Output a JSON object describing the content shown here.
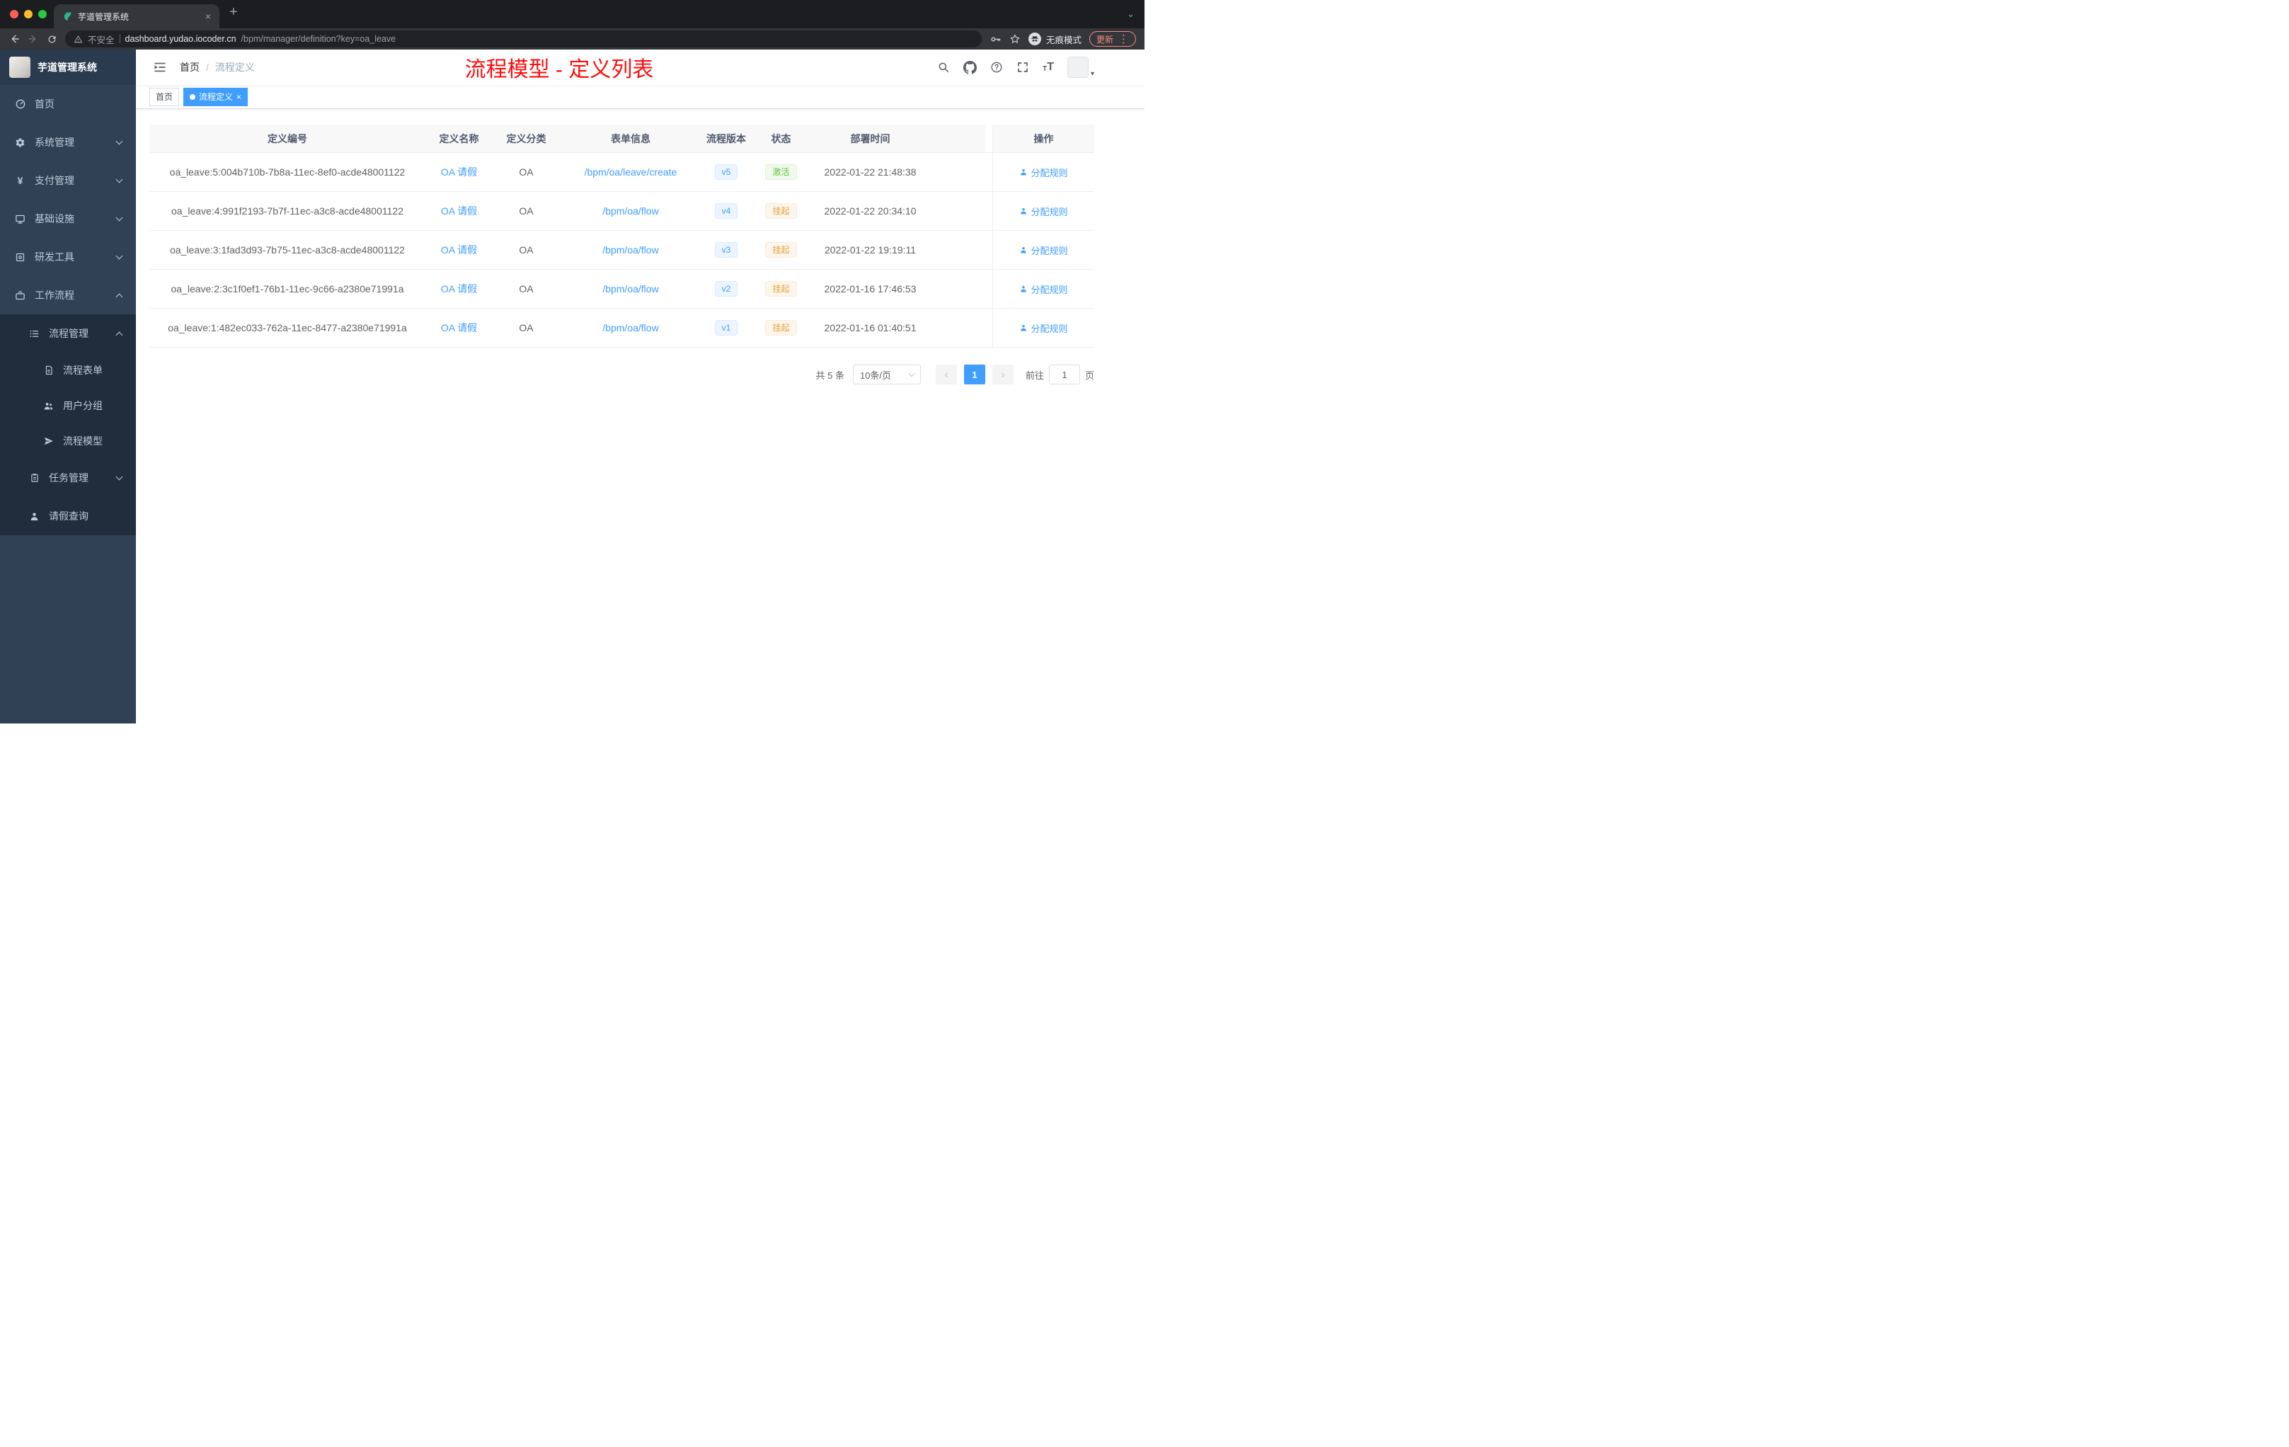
{
  "browser": {
    "tab_title": "芋道管理系统",
    "security_label": "不安全",
    "url_host": "dashboard.yudao.iocoder.cn",
    "url_path": "/bpm/manager/definition?key=oa_leave",
    "incognito_label": "无痕模式",
    "update_label": "更新"
  },
  "icons": {
    "close": "×",
    "plus": "+",
    "kebab": "⋮",
    "caret_down": "⌄",
    "avatar_caret": "▾",
    "prev": "‹",
    "next": "›"
  },
  "sidebar": {
    "app_title": "芋道管理系统",
    "items": [
      {
        "label": "首页"
      },
      {
        "label": "系统管理"
      },
      {
        "label": "支付管理"
      },
      {
        "label": "基础设施"
      },
      {
        "label": "研发工具"
      },
      {
        "label": "工作流程"
      },
      {
        "label": "流程管理"
      },
      {
        "label": "流程表单"
      },
      {
        "label": "用户分组"
      },
      {
        "label": "流程模型"
      },
      {
        "label": "任务管理"
      },
      {
        "label": "请假查询"
      }
    ]
  },
  "header": {
    "breadcrumb_home": "首页",
    "breadcrumb_separator": "/",
    "breadcrumb_current": "流程定义",
    "annotation": "流程模型 - 定义列表",
    "annotation_color": "#ff0b0b"
  },
  "tags": {
    "home": "首页",
    "active": "流程定义"
  },
  "table": {
    "columns": {
      "id": "定义编号",
      "name": "定义名称",
      "category": "定义分类",
      "form": "表单信息",
      "version": "流程版本",
      "status": "状态",
      "deployed": "部署时间",
      "action": "操作"
    },
    "rows": [
      {
        "id": "oa_leave:5:004b710b-7b8a-11ec-8ef0-acde48001122",
        "name": "OA 请假",
        "category": "OA",
        "form": "/bpm/oa/leave/create",
        "version": "v5",
        "status": "激活",
        "status_type": "success",
        "deployed": "2022-01-22 21:48:38",
        "action": "分配规则"
      },
      {
        "id": "oa_leave:4:991f2193-7b7f-11ec-a3c8-acde48001122",
        "name": "OA 请假",
        "category": "OA",
        "form": "/bpm/oa/flow",
        "version": "v4",
        "status": "挂起",
        "status_type": "warning",
        "deployed": "2022-01-22 20:34:10",
        "action": "分配规则"
      },
      {
        "id": "oa_leave:3:1fad3d93-7b75-11ec-a3c8-acde48001122",
        "name": "OA 请假",
        "category": "OA",
        "form": "/bpm/oa/flow",
        "version": "v3",
        "status": "挂起",
        "status_type": "warning",
        "deployed": "2022-01-22 19:19:11",
        "action": "分配规则"
      },
      {
        "id": "oa_leave:2:3c1f0ef1-76b1-11ec-9c66-a2380e71991a",
        "name": "OA 请假",
        "category": "OA",
        "form": "/bpm/oa/flow",
        "version": "v2",
        "status": "挂起",
        "status_type": "warning",
        "deployed": "2022-01-16 17:46:53",
        "action": "分配规则"
      },
      {
        "id": "oa_leave:1:482ec033-762a-11ec-8477-a2380e71991a",
        "name": "OA 请假",
        "category": "OA",
        "form": "/bpm/oa/flow",
        "version": "v1",
        "status": "挂起",
        "status_type": "warning",
        "deployed": "2022-01-16 01:40:51",
        "action": "分配规则"
      }
    ]
  },
  "pagination": {
    "total": "共 5 条",
    "page_size": "10条/页",
    "current_page": "1",
    "goto_label": "前往",
    "goto_value": "1",
    "unit_label": "页"
  },
  "colors": {
    "accent_blue": "#409eff",
    "success_green": "#67c23a",
    "warning_orange": "#e6a23c",
    "sidebar_bg": "#304156",
    "submenu_bg": "#1f2d3d",
    "annotation_red": "#ff0b0b"
  }
}
